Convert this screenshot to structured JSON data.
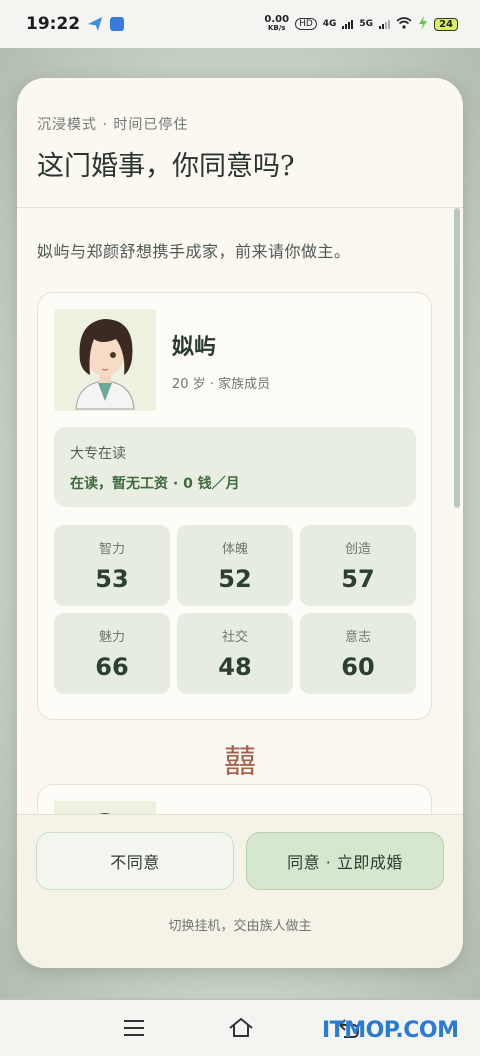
{
  "status_bar": {
    "time": "19:22",
    "net_speed_value": "0.00",
    "net_speed_unit": "KB/s",
    "chip": "HD",
    "sig1": "4G",
    "sig2": "5G",
    "battery": "24"
  },
  "dialog": {
    "subtitle": "沉浸模式 · 时间已停住",
    "title": "这门婚事，你同意吗?",
    "intro": "姒屿与郑颜舒想携手成家，前来请你做主。",
    "person": {
      "name": "姒屿",
      "meta": "20 岁 · 家族成员",
      "education": "大专在读",
      "income": "在读，暂无工资 · 0 钱／月",
      "stats": [
        {
          "label": "智力",
          "value": "53"
        },
        {
          "label": "体魄",
          "value": "52"
        },
        {
          "label": "创造",
          "value": "57"
        },
        {
          "label": "魅力",
          "value": "66"
        },
        {
          "label": "社交",
          "value": "48"
        },
        {
          "label": "意志",
          "value": "60"
        }
      ]
    },
    "symbol": "囍",
    "reject_label": "不同意",
    "accept_label": "同意 · 立即成婚",
    "footer_link": "切换挂机，交由族人做主"
  },
  "watermark": "ITMOP.COM"
}
